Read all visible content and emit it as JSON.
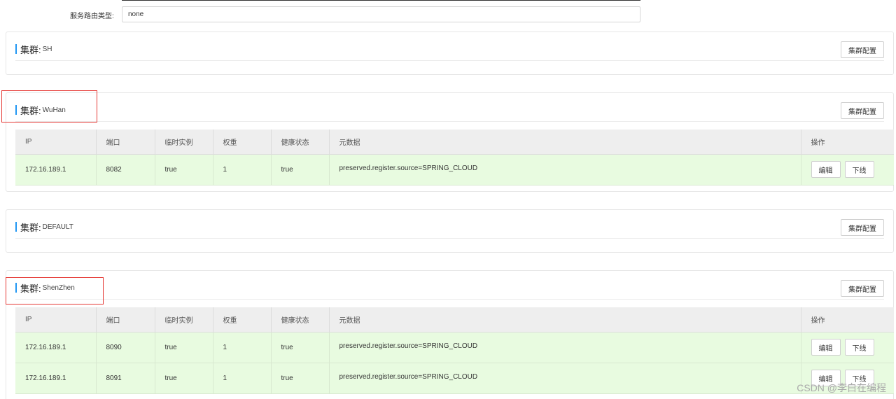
{
  "route": {
    "label": "服务路由类型:",
    "value": "none"
  },
  "table_headers": [
    "IP",
    "端口",
    "临时实例",
    "权重",
    "健康状态",
    "元数据",
    "操作"
  ],
  "clusters": [
    {
      "title": "集群:",
      "name": "SH",
      "config_label": "集群配置",
      "instances": []
    },
    {
      "title": "集群:",
      "name": "WuHan",
      "config_label": "集群配置",
      "instances": [
        {
          "ip": "172.16.189.1",
          "port": "8082",
          "ephemeral": "true",
          "weight": "1",
          "healthy": "true",
          "metadata": "preserved.register.source=SPRING_CLOUD",
          "edit_label": "编辑",
          "offline_label": "下线"
        }
      ]
    },
    {
      "title": "集群:",
      "name": "DEFAULT",
      "config_label": "集群配置",
      "instances": []
    },
    {
      "title": "集群:",
      "name": "ShenZhen",
      "config_label": "集群配置",
      "instances": [
        {
          "ip": "172.16.189.1",
          "port": "8090",
          "ephemeral": "true",
          "weight": "1",
          "healthy": "true",
          "metadata": "preserved.register.source=SPRING_CLOUD",
          "edit_label": "编辑",
          "offline_label": "下线"
        },
        {
          "ip": "172.16.189.1",
          "port": "8091",
          "ephemeral": "true",
          "weight": "1",
          "healthy": "true",
          "metadata": "preserved.register.source=SPRING_CLOUD",
          "edit_label": "编辑",
          "offline_label": "下线"
        }
      ]
    }
  ],
  "watermark": "CSDN @李白在编程",
  "colors": {
    "accent": "#2196f3",
    "highlight": "#e53935",
    "row_bg": "#e8fbe0"
  }
}
